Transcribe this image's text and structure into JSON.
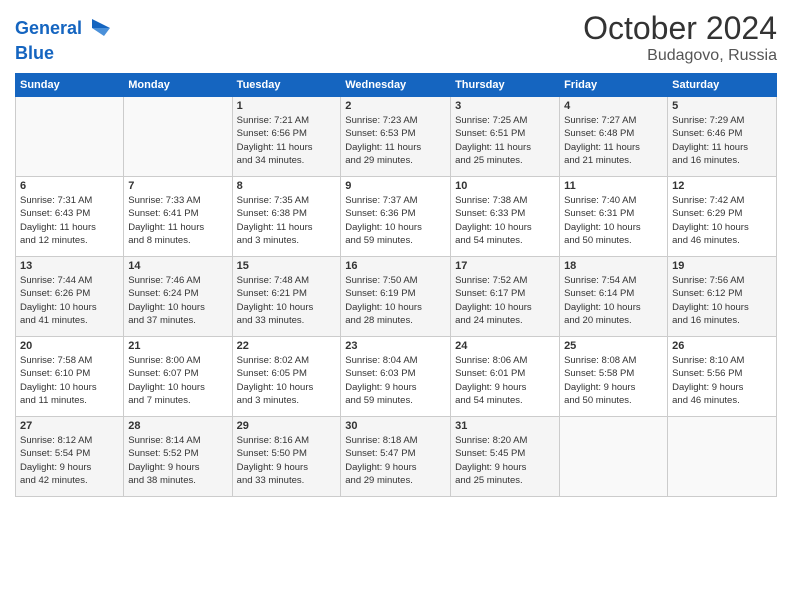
{
  "header": {
    "logo_line1": "General",
    "logo_line2": "Blue",
    "month": "October 2024",
    "location": "Budagovo, Russia"
  },
  "weekdays": [
    "Sunday",
    "Monday",
    "Tuesday",
    "Wednesday",
    "Thursday",
    "Friday",
    "Saturday"
  ],
  "weeks": [
    [
      {
        "day": "",
        "info": ""
      },
      {
        "day": "",
        "info": ""
      },
      {
        "day": "1",
        "info": "Sunrise: 7:21 AM\nSunset: 6:56 PM\nDaylight: 11 hours\nand 34 minutes."
      },
      {
        "day": "2",
        "info": "Sunrise: 7:23 AM\nSunset: 6:53 PM\nDaylight: 11 hours\nand 29 minutes."
      },
      {
        "day": "3",
        "info": "Sunrise: 7:25 AM\nSunset: 6:51 PM\nDaylight: 11 hours\nand 25 minutes."
      },
      {
        "day": "4",
        "info": "Sunrise: 7:27 AM\nSunset: 6:48 PM\nDaylight: 11 hours\nand 21 minutes."
      },
      {
        "day": "5",
        "info": "Sunrise: 7:29 AM\nSunset: 6:46 PM\nDaylight: 11 hours\nand 16 minutes."
      }
    ],
    [
      {
        "day": "6",
        "info": "Sunrise: 7:31 AM\nSunset: 6:43 PM\nDaylight: 11 hours\nand 12 minutes."
      },
      {
        "day": "7",
        "info": "Sunrise: 7:33 AM\nSunset: 6:41 PM\nDaylight: 11 hours\nand 8 minutes."
      },
      {
        "day": "8",
        "info": "Sunrise: 7:35 AM\nSunset: 6:38 PM\nDaylight: 11 hours\nand 3 minutes."
      },
      {
        "day": "9",
        "info": "Sunrise: 7:37 AM\nSunset: 6:36 PM\nDaylight: 10 hours\nand 59 minutes."
      },
      {
        "day": "10",
        "info": "Sunrise: 7:38 AM\nSunset: 6:33 PM\nDaylight: 10 hours\nand 54 minutes."
      },
      {
        "day": "11",
        "info": "Sunrise: 7:40 AM\nSunset: 6:31 PM\nDaylight: 10 hours\nand 50 minutes."
      },
      {
        "day": "12",
        "info": "Sunrise: 7:42 AM\nSunset: 6:29 PM\nDaylight: 10 hours\nand 46 minutes."
      }
    ],
    [
      {
        "day": "13",
        "info": "Sunrise: 7:44 AM\nSunset: 6:26 PM\nDaylight: 10 hours\nand 41 minutes."
      },
      {
        "day": "14",
        "info": "Sunrise: 7:46 AM\nSunset: 6:24 PM\nDaylight: 10 hours\nand 37 minutes."
      },
      {
        "day": "15",
        "info": "Sunrise: 7:48 AM\nSunset: 6:21 PM\nDaylight: 10 hours\nand 33 minutes."
      },
      {
        "day": "16",
        "info": "Sunrise: 7:50 AM\nSunset: 6:19 PM\nDaylight: 10 hours\nand 28 minutes."
      },
      {
        "day": "17",
        "info": "Sunrise: 7:52 AM\nSunset: 6:17 PM\nDaylight: 10 hours\nand 24 minutes."
      },
      {
        "day": "18",
        "info": "Sunrise: 7:54 AM\nSunset: 6:14 PM\nDaylight: 10 hours\nand 20 minutes."
      },
      {
        "day": "19",
        "info": "Sunrise: 7:56 AM\nSunset: 6:12 PM\nDaylight: 10 hours\nand 16 minutes."
      }
    ],
    [
      {
        "day": "20",
        "info": "Sunrise: 7:58 AM\nSunset: 6:10 PM\nDaylight: 10 hours\nand 11 minutes."
      },
      {
        "day": "21",
        "info": "Sunrise: 8:00 AM\nSunset: 6:07 PM\nDaylight: 10 hours\nand 7 minutes."
      },
      {
        "day": "22",
        "info": "Sunrise: 8:02 AM\nSunset: 6:05 PM\nDaylight: 10 hours\nand 3 minutes."
      },
      {
        "day": "23",
        "info": "Sunrise: 8:04 AM\nSunset: 6:03 PM\nDaylight: 9 hours\nand 59 minutes."
      },
      {
        "day": "24",
        "info": "Sunrise: 8:06 AM\nSunset: 6:01 PM\nDaylight: 9 hours\nand 54 minutes."
      },
      {
        "day": "25",
        "info": "Sunrise: 8:08 AM\nSunset: 5:58 PM\nDaylight: 9 hours\nand 50 minutes."
      },
      {
        "day": "26",
        "info": "Sunrise: 8:10 AM\nSunset: 5:56 PM\nDaylight: 9 hours\nand 46 minutes."
      }
    ],
    [
      {
        "day": "27",
        "info": "Sunrise: 8:12 AM\nSunset: 5:54 PM\nDaylight: 9 hours\nand 42 minutes."
      },
      {
        "day": "28",
        "info": "Sunrise: 8:14 AM\nSunset: 5:52 PM\nDaylight: 9 hours\nand 38 minutes."
      },
      {
        "day": "29",
        "info": "Sunrise: 8:16 AM\nSunset: 5:50 PM\nDaylight: 9 hours\nand 33 minutes."
      },
      {
        "day": "30",
        "info": "Sunrise: 8:18 AM\nSunset: 5:47 PM\nDaylight: 9 hours\nand 29 minutes."
      },
      {
        "day": "31",
        "info": "Sunrise: 8:20 AM\nSunset: 5:45 PM\nDaylight: 9 hours\nand 25 minutes."
      },
      {
        "day": "",
        "info": ""
      },
      {
        "day": "",
        "info": ""
      }
    ]
  ]
}
